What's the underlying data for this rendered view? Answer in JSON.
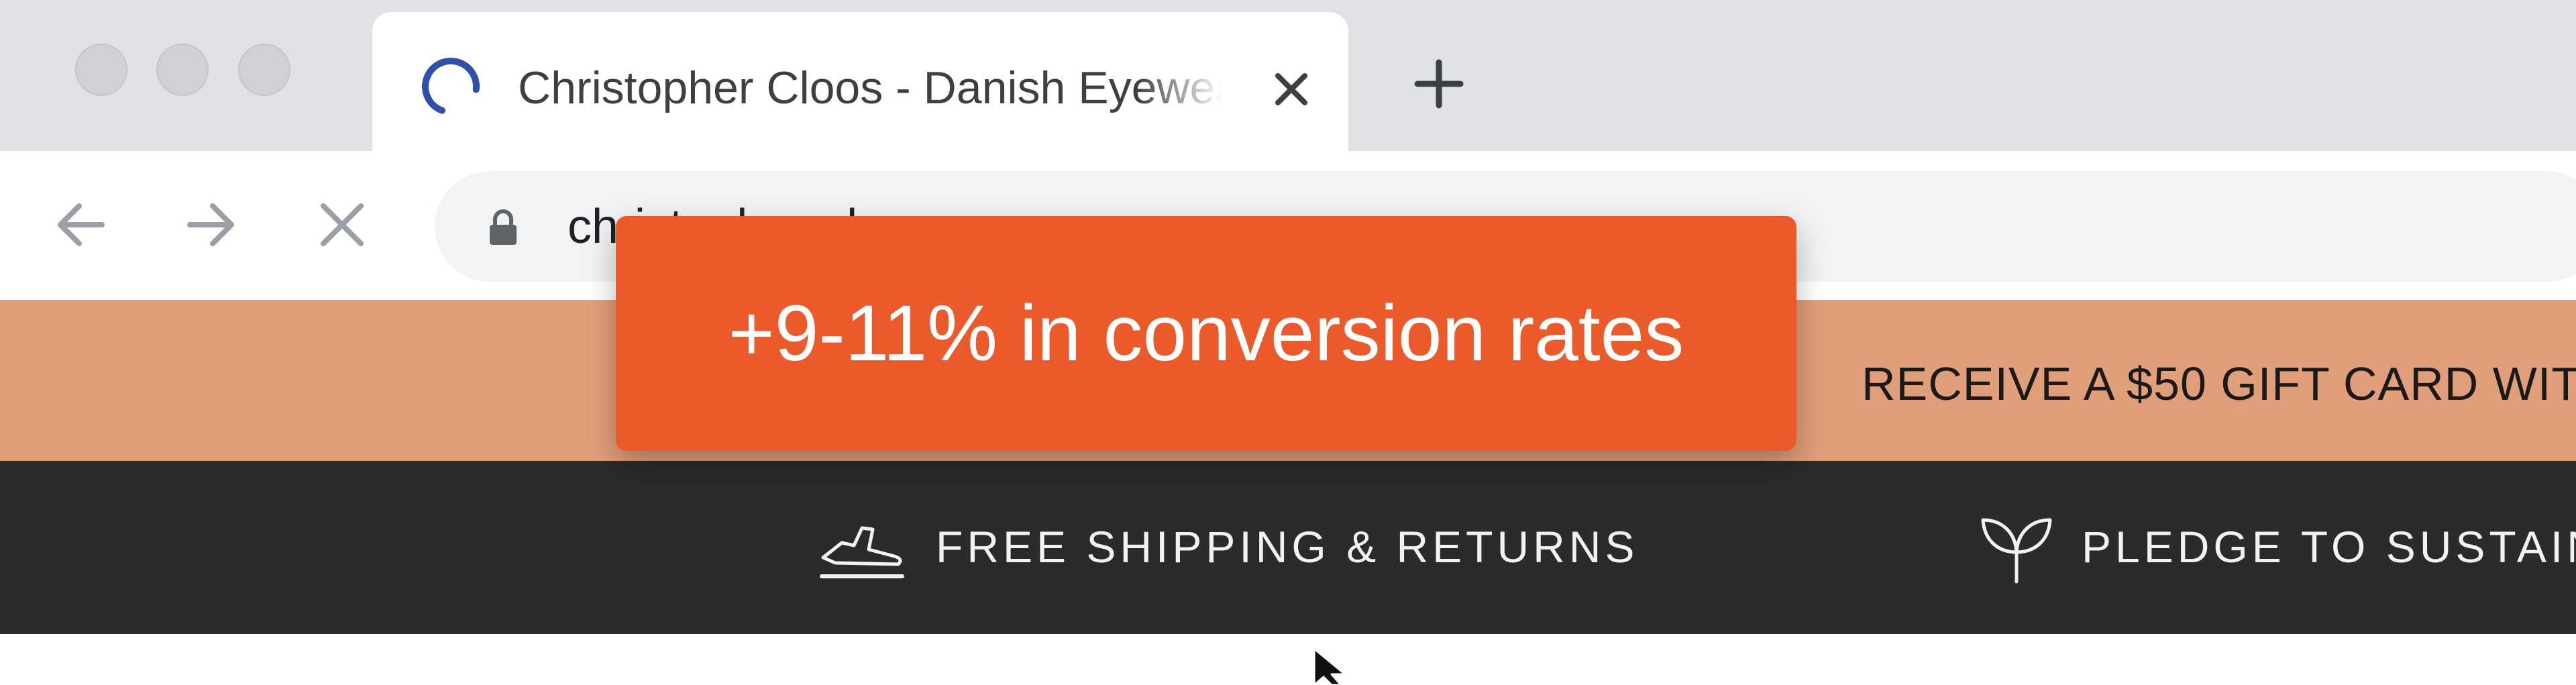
{
  "browser": {
    "tab": {
      "title": "Christopher Cloos - Danish Eyewear",
      "loading": true
    },
    "address_bar": {
      "url": "christopher-cloos.com"
    },
    "icons": {
      "back": "arrow-left-icon",
      "forward": "arrow-right-icon",
      "stop": "close-icon",
      "lock": "lock-icon",
      "new_tab": "plus-icon",
      "tab_close": "close-icon"
    },
    "colors": {
      "spinner": "#2f4fa8"
    }
  },
  "page": {
    "promo_banner": {
      "text": "RECEIVE A $50 GIFT CARD WIT",
      "background": "#e19e7b"
    },
    "feature_strip": {
      "background": "#2b2b2b",
      "items": [
        {
          "icon": "airplane-icon",
          "label": "FREE SHIPPING & RETURNS"
        },
        {
          "icon": "sprout-icon",
          "label": "PLEDGE TO SUSTAINAI"
        }
      ]
    }
  },
  "overlay": {
    "callout": {
      "text": "+9-11% in conversion rates",
      "background": "#ea5a2b"
    }
  }
}
